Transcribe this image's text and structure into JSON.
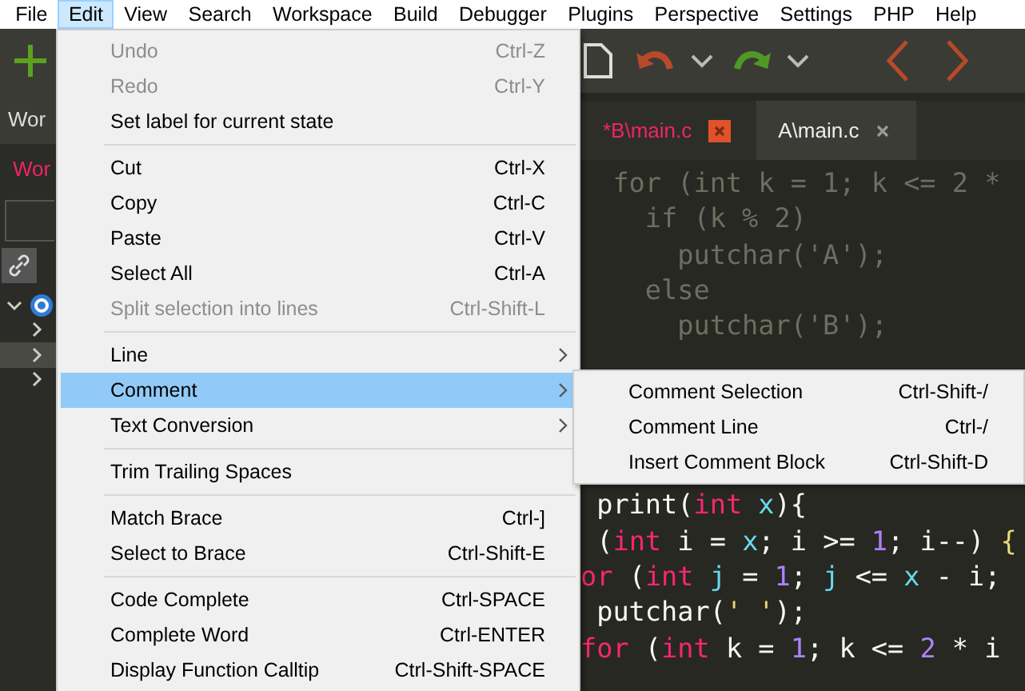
{
  "menubar": [
    {
      "label": "File",
      "selected": false
    },
    {
      "label": "Edit",
      "selected": true
    },
    {
      "label": "View",
      "selected": false
    },
    {
      "label": "Search",
      "selected": false
    },
    {
      "label": "Workspace",
      "selected": false
    },
    {
      "label": "Build",
      "selected": false
    },
    {
      "label": "Debugger",
      "selected": false
    },
    {
      "label": "Plugins",
      "selected": false
    },
    {
      "label": "Perspective",
      "selected": false
    },
    {
      "label": "Settings",
      "selected": false
    },
    {
      "label": "PHP",
      "selected": false
    },
    {
      "label": "Help",
      "selected": false
    }
  ],
  "sidebar": {
    "tab": "Wor",
    "title": "Wor",
    "tree": [
      {
        "expanded": true,
        "selected": false,
        "children": [
          {
            "expanded": false,
            "selected": false
          },
          {
            "expanded": false,
            "selected": true
          },
          {
            "expanded": false,
            "selected": false
          }
        ]
      }
    ]
  },
  "editor": {
    "tabs": [
      {
        "label": "*B\\main.c",
        "selected": true
      },
      {
        "label": "A\\main.c",
        "selected": false
      }
    ],
    "code_top": [
      [
        {
          "text": "  for (int k = 1; k <= 2 *",
          "kind": "dim"
        }
      ],
      [
        {
          "text": "    if (k % 2)",
          "kind": "dim"
        }
      ],
      [
        {
          "text": "      putchar('A');",
          "kind": "dim"
        }
      ],
      [
        {
          "text": "    else",
          "kind": "dim"
        }
      ],
      [
        {
          "text": "      putchar('B');",
          "kind": "dim"
        }
      ]
    ],
    "code_bottom": [
      [
        {
          "text": " print(",
          "kind": "plain"
        },
        {
          "text": "int",
          "kind": "keyword"
        },
        {
          "text": " x",
          "kind": "variable"
        },
        {
          "text": "){",
          "kind": "plain"
        }
      ],
      [
        {
          "text": " (",
          "kind": "plain"
        },
        {
          "text": "int",
          "kind": "keyword"
        },
        {
          "text": " i = ",
          "kind": "plain"
        },
        {
          "text": "x",
          "kind": "variable"
        },
        {
          "text": "; i >= ",
          "kind": "plain"
        },
        {
          "text": "1",
          "kind": "number"
        },
        {
          "text": "; i--) ",
          "kind": "plain"
        },
        {
          "text": "{",
          "kind": "brace"
        }
      ],
      [
        {
          "text": "or",
          "kind": "keyword"
        },
        {
          "text": " (",
          "kind": "plain"
        },
        {
          "text": "int",
          "kind": "keyword"
        },
        {
          "text": " j",
          "kind": "variable"
        },
        {
          "text": " = ",
          "kind": "plain"
        },
        {
          "text": "1",
          "kind": "number"
        },
        {
          "text": "; ",
          "kind": "plain"
        },
        {
          "text": "j",
          "kind": "variable"
        },
        {
          "text": " <= ",
          "kind": "plain"
        },
        {
          "text": "x",
          "kind": "variable"
        },
        {
          "text": " - i;",
          "kind": "plain"
        }
      ],
      [
        {
          "text": " putchar(",
          "kind": "plain"
        },
        {
          "text": "' '",
          "kind": "string"
        },
        {
          "text": ");",
          "kind": "plain"
        }
      ],
      [
        {
          "text": "for",
          "kind": "keyword"
        },
        {
          "text": " (",
          "kind": "plain"
        },
        {
          "text": "int",
          "kind": "keyword"
        },
        {
          "text": " k = ",
          "kind": "plain"
        },
        {
          "text": "1",
          "kind": "number"
        },
        {
          "text": "; k <= ",
          "kind": "plain"
        },
        {
          "text": "2",
          "kind": "number"
        },
        {
          "text": " * i",
          "kind": "plain"
        }
      ]
    ]
  },
  "edit_menu": {
    "items": [
      {
        "kind": "item",
        "label": "Undo",
        "shortcut": "Ctrl-Z",
        "disabled": true,
        "selected": false
      },
      {
        "kind": "item",
        "label": "Redo",
        "shortcut": "Ctrl-Y",
        "disabled": true,
        "selected": false
      },
      {
        "kind": "item",
        "label": "Set label for current state",
        "disabled": false,
        "selected": false
      },
      {
        "kind": "separator"
      },
      {
        "kind": "item",
        "label": "Cut",
        "shortcut": "Ctrl-X",
        "disabled": false,
        "selected": false
      },
      {
        "kind": "item",
        "label": "Copy",
        "shortcut": "Ctrl-C",
        "disabled": false,
        "selected": false
      },
      {
        "kind": "item",
        "label": "Paste",
        "shortcut": "Ctrl-V",
        "disabled": false,
        "selected": false
      },
      {
        "kind": "item",
        "label": "Select All",
        "shortcut": "Ctrl-A",
        "disabled": false,
        "selected": false
      },
      {
        "kind": "item",
        "label": "Split selection into lines",
        "shortcut": "Ctrl-Shift-L",
        "disabled": true,
        "selected": false
      },
      {
        "kind": "separator"
      },
      {
        "kind": "submenu",
        "label": "Line",
        "disabled": false,
        "selected": false
      },
      {
        "kind": "submenu",
        "label": "Comment",
        "disabled": false,
        "selected": true
      },
      {
        "kind": "submenu",
        "label": "Text Conversion",
        "disabled": false,
        "selected": false
      },
      {
        "kind": "separator"
      },
      {
        "kind": "item",
        "label": "Trim Trailing Spaces",
        "disabled": false,
        "selected": false
      },
      {
        "kind": "separator"
      },
      {
        "kind": "item",
        "label": "Match Brace",
        "shortcut": "Ctrl-]",
        "disabled": false,
        "selected": false
      },
      {
        "kind": "item",
        "label": "Select to Brace",
        "shortcut": "Ctrl-Shift-E",
        "disabled": false,
        "selected": false
      },
      {
        "kind": "separator"
      },
      {
        "kind": "item",
        "label": "Code Complete",
        "shortcut": "Ctrl-SPACE",
        "disabled": false,
        "selected": false
      },
      {
        "kind": "item",
        "label": "Complete Word",
        "shortcut": "Ctrl-ENTER",
        "disabled": false,
        "selected": false
      },
      {
        "kind": "item",
        "label": "Display Function Calltip",
        "shortcut": "Ctrl-Shift-SPACE",
        "disabled": false,
        "selected": false
      }
    ]
  },
  "comment_submenu": {
    "items": [
      {
        "kind": "item",
        "label": "Comment Selection",
        "shortcut": "Ctrl-Shift-/",
        "disabled": false,
        "selected": false
      },
      {
        "kind": "item",
        "label": "Comment Line",
        "shortcut": "Ctrl-/",
        "disabled": false,
        "selected": false
      },
      {
        "kind": "item",
        "label": "Insert Comment Block",
        "shortcut": "Ctrl-Shift-D",
        "disabled": false,
        "selected": false
      }
    ]
  }
}
